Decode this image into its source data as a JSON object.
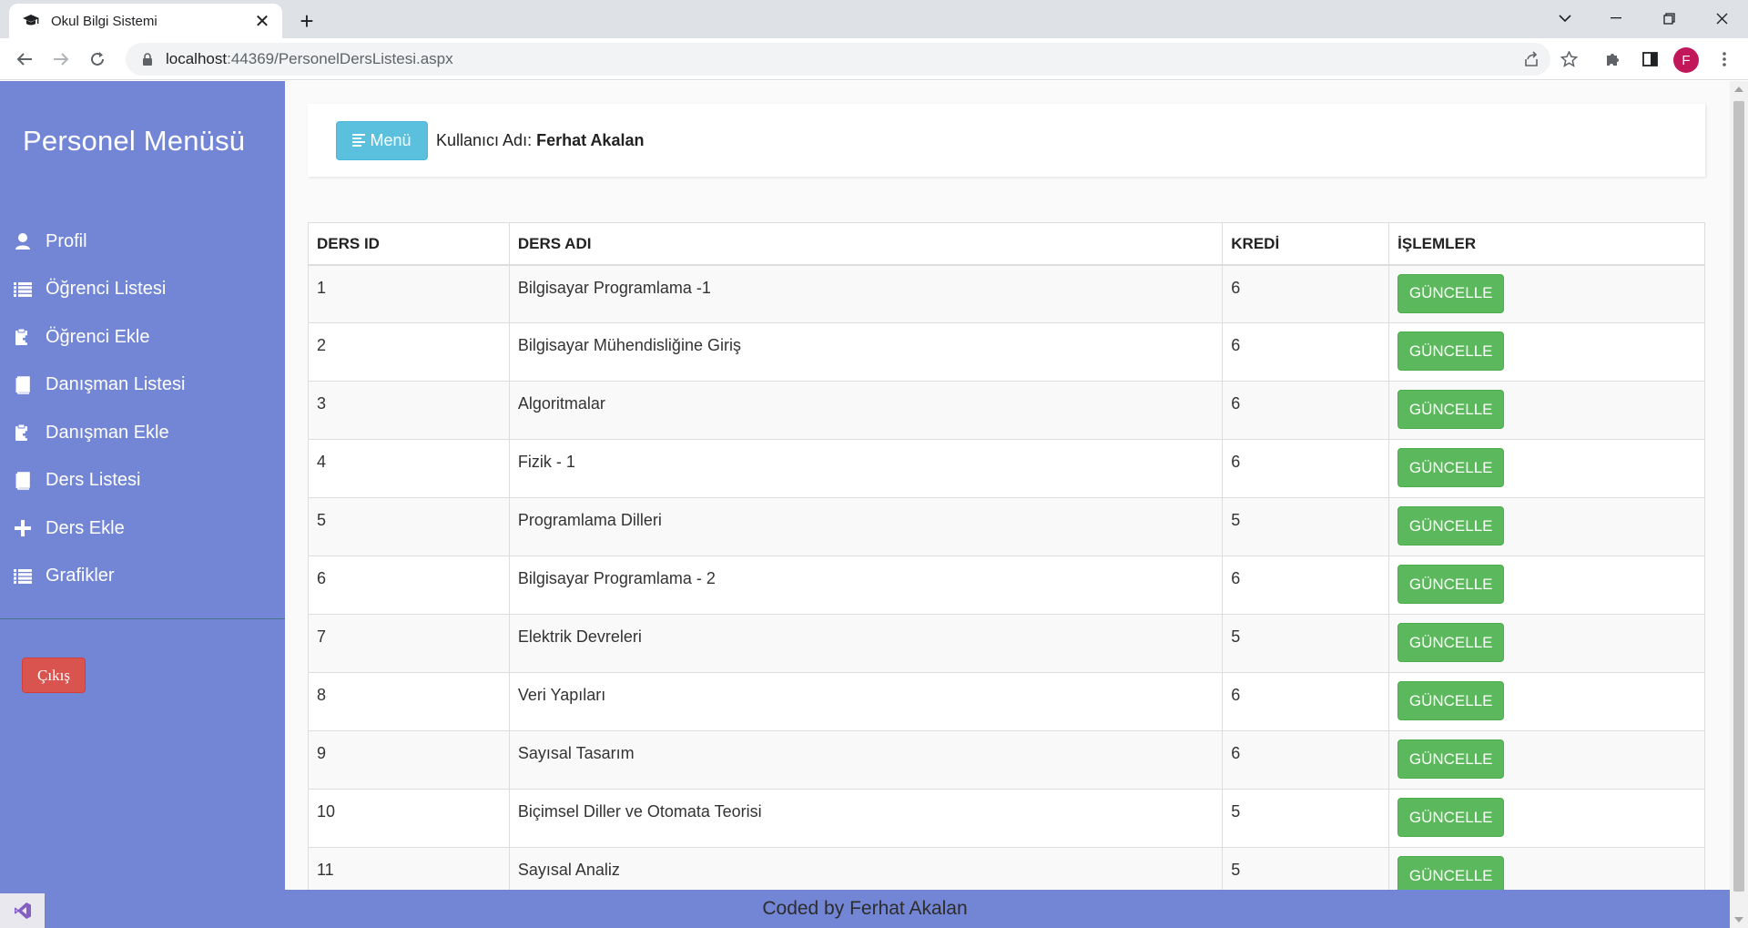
{
  "browser": {
    "tab_title": "Okul Bilgi Sistemi",
    "tab_close": "✕",
    "new_tab": "+",
    "url_host": "localhost",
    "url_rest": ":44369/PersonelDersListesi.aspx",
    "profile_initial": "F"
  },
  "sidebar": {
    "title": "Personel Menüsü",
    "items": [
      {
        "label": "Profil",
        "icon": "user-icon"
      },
      {
        "label": "Öğrenci Listesi",
        "icon": "list-icon"
      },
      {
        "label": "Öğrenci Ekle",
        "icon": "clipboard-add-icon"
      },
      {
        "label": "Danışman Listesi",
        "icon": "book-icon"
      },
      {
        "label": "Danışman Ekle",
        "icon": "clipboard-add-icon"
      },
      {
        "label": "Ders Listesi",
        "icon": "book-icon"
      },
      {
        "label": "Ders Ekle",
        "icon": "plus-icon"
      },
      {
        "label": "Grafikler",
        "icon": "list-icon"
      }
    ],
    "logout_label": "Çıkış"
  },
  "header": {
    "menu_label": "Menü",
    "user_prefix": "Kullanıcı Adı:",
    "user_name": "Ferhat Akalan"
  },
  "table": {
    "columns": [
      "DERS ID",
      "DERS ADI",
      "KREDİ",
      "İŞLEMLER"
    ],
    "rows": [
      {
        "id": "1",
        "name": "Bilgisayar Programlama -1",
        "credit": "6",
        "action": "GÜNCELLE"
      },
      {
        "id": "2",
        "name": "Bilgisayar Mühendisliğine Giriş",
        "credit": "6",
        "action": "GÜNCELLE"
      },
      {
        "id": "3",
        "name": "Algoritmalar",
        "credit": "6",
        "action": "GÜNCELLE"
      },
      {
        "id": "4",
        "name": "Fizik - 1",
        "credit": "6",
        "action": "GÜNCELLE"
      },
      {
        "id": "5",
        "name": "Programlama Dilleri",
        "credit": "5",
        "action": "GÜNCELLE"
      },
      {
        "id": "6",
        "name": "Bilgisayar Programlama - 2",
        "credit": "6",
        "action": "GÜNCELLE"
      },
      {
        "id": "7",
        "name": "Elektrik Devreleri",
        "credit": "5",
        "action": "GÜNCELLE"
      },
      {
        "id": "8",
        "name": "Veri Yapıları",
        "credit": "6",
        "action": "GÜNCELLE"
      },
      {
        "id": "9",
        "name": "Sayısal Tasarım",
        "credit": "6",
        "action": "GÜNCELLE"
      },
      {
        "id": "10",
        "name": "Biçimsel Diller ve Otomata Teorisi",
        "credit": "5",
        "action": "GÜNCELLE"
      },
      {
        "id": "11",
        "name": "Sayısal Analiz",
        "credit": "5",
        "action": "GÜNCELLE"
      }
    ]
  },
  "footer": {
    "credit": "Coded by Ferhat Akalan"
  },
  "colors": {
    "sidebar_bg": "#7386d5",
    "menu_btn": "#5bc0de",
    "update_btn": "#5cb85c",
    "logout_btn": "#d9534f"
  }
}
